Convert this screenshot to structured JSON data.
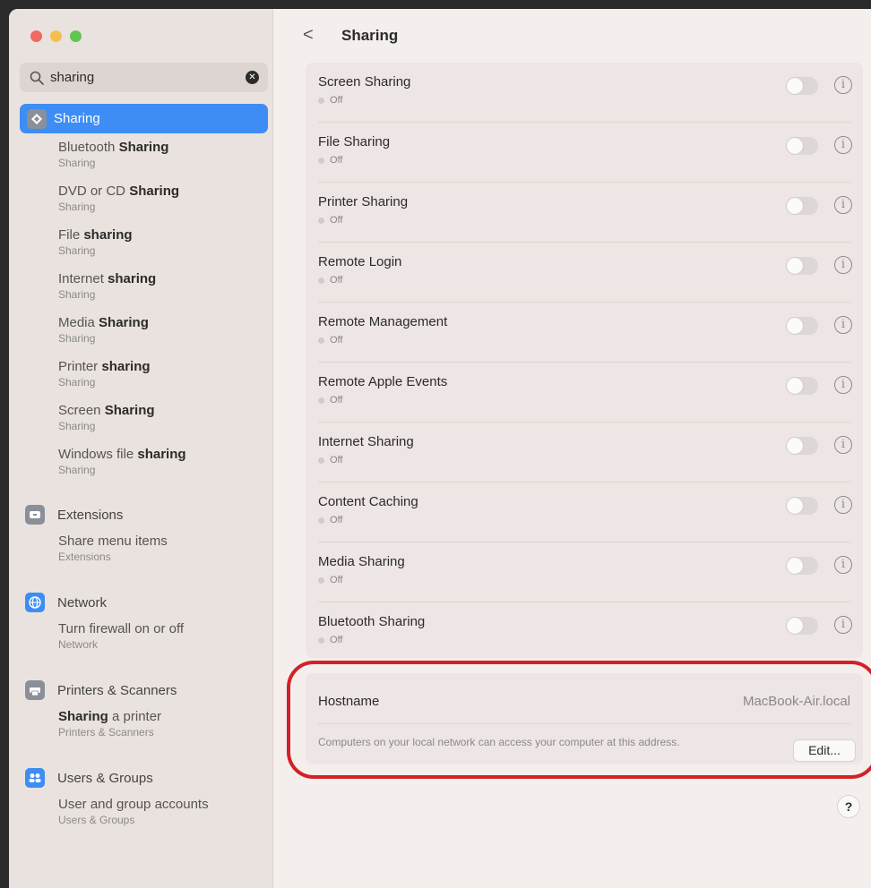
{
  "window": {
    "traffic_lights": [
      {
        "name": "close",
        "color": "#ec6a5e"
      },
      {
        "name": "minimize",
        "color": "#f4bf4f"
      },
      {
        "name": "zoom",
        "color": "#61c554"
      }
    ]
  },
  "search": {
    "value": "sharing",
    "clear_glyph": "✕",
    "icon": "search-icon"
  },
  "sidebar": {
    "selected": {
      "label": "Sharing",
      "icon": "sharing-icon",
      "accent": "#3d8df5"
    },
    "sharing_results": [
      {
        "pre": "Bluetooth ",
        "bold": "Sharing",
        "post": "",
        "sub": "Sharing"
      },
      {
        "pre": "DVD or CD ",
        "bold": "Sharing",
        "post": "",
        "sub": "Sharing"
      },
      {
        "pre": "File ",
        "bold": "sharing",
        "post": "",
        "sub": "Sharing"
      },
      {
        "pre": "Internet ",
        "bold": "sharing",
        "post": "",
        "sub": "Sharing"
      },
      {
        "pre": "Media ",
        "bold": "Sharing",
        "post": "",
        "sub": "Sharing"
      },
      {
        "pre": "Printer ",
        "bold": "sharing",
        "post": "",
        "sub": "Sharing"
      },
      {
        "pre": "Screen ",
        "bold": "Sharing",
        "post": "",
        "sub": "Sharing"
      },
      {
        "pre": "Windows file ",
        "bold": "sharing",
        "post": "",
        "sub": "Sharing"
      }
    ],
    "categories": [
      {
        "label": "Extensions",
        "icon": "extensions-icon",
        "icon_color": "#8a8f99",
        "results": [
          {
            "pre": "Share menu items",
            "bold": "",
            "post": "",
            "sub": "Extensions"
          }
        ]
      },
      {
        "label": "Network",
        "icon": "network-icon",
        "icon_color": "#3d8df5",
        "results": [
          {
            "pre": "Turn firewall on or off",
            "bold": "",
            "post": "",
            "sub": "Network"
          }
        ]
      },
      {
        "label": "Printers & Scanners",
        "icon": "printer-icon",
        "icon_color": "#8a8f99",
        "results": [
          {
            "pre": "",
            "bold": "Sharing",
            "post": " a printer",
            "sub": "Printers & Scanners"
          }
        ]
      },
      {
        "label": "Users & Groups",
        "icon": "users-icon",
        "icon_color": "#3d8df5",
        "results": [
          {
            "pre": "User and group accounts",
            "bold": "",
            "post": "",
            "sub": "Users & Groups"
          }
        ]
      }
    ]
  },
  "main": {
    "back_glyph": "<",
    "title": "Sharing",
    "services": [
      {
        "name": "Screen Sharing",
        "status": "Off",
        "enabled": false
      },
      {
        "name": "File Sharing",
        "status": "Off",
        "enabled": false
      },
      {
        "name": "Printer Sharing",
        "status": "Off",
        "enabled": false
      },
      {
        "name": "Remote Login",
        "status": "Off",
        "enabled": false
      },
      {
        "name": "Remote Management",
        "status": "Off",
        "enabled": false
      },
      {
        "name": "Remote Apple Events",
        "status": "Off",
        "enabled": false
      },
      {
        "name": "Internet Sharing",
        "status": "Off",
        "enabled": false
      },
      {
        "name": "Content Caching",
        "status": "Off",
        "enabled": false
      },
      {
        "name": "Media Sharing",
        "status": "Off",
        "enabled": false
      },
      {
        "name": "Bluetooth Sharing",
        "status": "Off",
        "enabled": false
      }
    ],
    "info_glyph": "i",
    "hostname": {
      "label": "Hostname",
      "value": "MacBook-Air.local",
      "description": "Computers on your local network can access your computer at this address.",
      "edit_label": "Edit..."
    },
    "help_glyph": "?",
    "annotation_color": "#d42027"
  }
}
